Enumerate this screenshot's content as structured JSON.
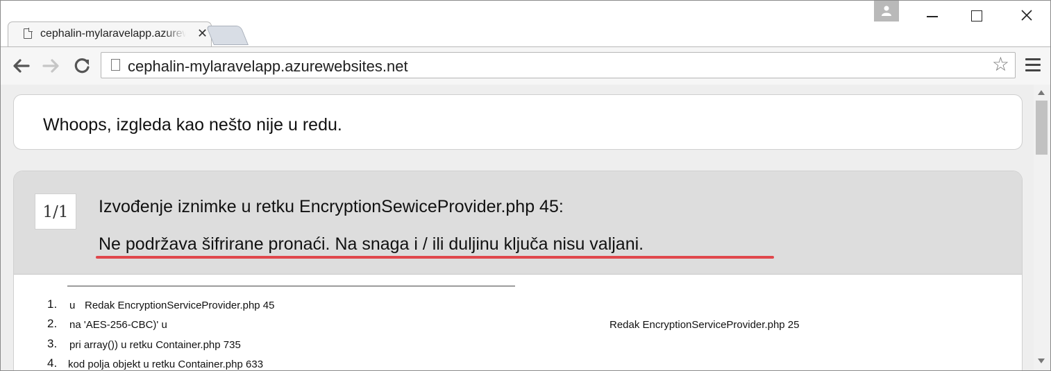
{
  "browser": {
    "tab_title": "cephalin-mylaravelapp.azurewebsites.net",
    "tab_close": "✕",
    "url": "cephalin-mylaravelapp.azurewebsites.net",
    "star": "☆"
  },
  "error_page": {
    "headline": "Whoops, izgleda kao nešto nije u redu.",
    "counter": "1/1",
    "exception_title": "Izvođenje iznimke u retku EncryptionSewiceProvider.php 45:",
    "exception_message": "Ne podržava šifrirane pronaći. Na snaga i / ili duljinu ključa nisu valjani.",
    "highlight_color": "#e0474c",
    "frames": [
      {
        "num": "1.",
        "prefix": "u",
        "text": "Redak EncryptionServiceProvider.php 45",
        "extra": ""
      },
      {
        "num": "2.",
        "prefix": "na 'AES-256-CBC)' u",
        "text": "",
        "extra": "Redak EncryptionServiceProvider.php 25"
      },
      {
        "num": "3.",
        "prefix": "pri array()) u retku Container.php 735",
        "text": "",
        "extra": ""
      },
      {
        "num": "4.",
        "prefix": "kod polja objekt u retku Container.php 633",
        "text": "",
        "extra": ""
      }
    ]
  }
}
